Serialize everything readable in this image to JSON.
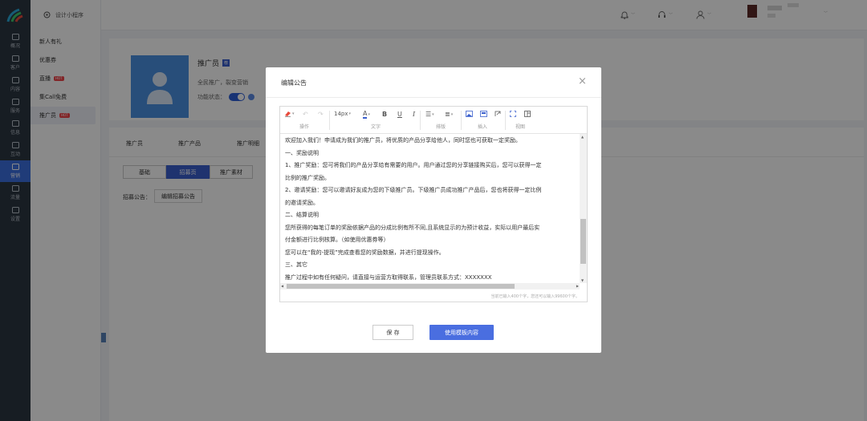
{
  "app_title": "设计小程序",
  "left_nav": [
    {
      "label": "概况",
      "icon": "bar-chart-icon"
    },
    {
      "label": "客户",
      "icon": "users-icon"
    },
    {
      "label": "内容",
      "icon": "document-icon"
    },
    {
      "label": "服务",
      "icon": "service-icon"
    },
    {
      "label": "信息",
      "icon": "message-icon"
    },
    {
      "label": "互动",
      "icon": "chat-icon"
    },
    {
      "label": "营销",
      "icon": "tag-icon",
      "active": true
    },
    {
      "label": "流量",
      "icon": "megaphone-icon"
    },
    {
      "label": "设置",
      "icon": "gear-icon"
    }
  ],
  "sub_nav": [
    {
      "label": "新人有礼"
    },
    {
      "label": "优惠券"
    },
    {
      "label": "直播",
      "hot": "HOT"
    },
    {
      "label": "集Call免费"
    },
    {
      "label": "推广员",
      "hot": "HOT",
      "active": true
    }
  ],
  "page": {
    "title": "推广员",
    "title_badge": "荐",
    "desc": "全民推广，裂变营销",
    "status_label": "功能状态：",
    "tabs": [
      "推广员",
      "推广产品",
      "推广明细"
    ],
    "segments": [
      "基础",
      "招募页",
      "推广素材"
    ],
    "notice_label": "招募公告：",
    "notice_button": "编辑招募公告"
  },
  "modal": {
    "title": "编辑公告",
    "toolbar_groups": [
      "操作",
      "文字",
      "排版",
      "插入",
      "视图"
    ],
    "font_size": "14px",
    "content_lines": [
      "欢迎加入我们！申请成为我们的推广员，将优质的产品分享给他人，同时您也可获取一定奖励。",
      "一、奖励说明",
      "1、推广奖励：您可将我们的产品分享给有需要的用户。用户通过您的分享链接购买后，您可以获得一定",
      "比例的推广奖励。",
      "2、邀请奖励：您可以邀请好友成为您的下级推广员。下级推广员成功推广产品后，您也将获得一定比例",
      "的邀请奖励。",
      "二、结算说明",
      "您所获得的每笔订单的奖励依据产品的分成比例有所不同,且系统显示的为预计收益，实际以用户最后实",
      "付金额进行比例核算。（如使用优惠券等）",
      "您可以在“我的-提现”完成查看您的奖励数据，并进行提现操作。",
      "三、其它",
      "推广过程中如有任何疑问，请直接与运营方取得联系，管理员联系方式：XXXXXXX"
    ],
    "counter": "当前已输入400个字，您还可以输入99600个字。",
    "save_button": "保 存",
    "template_button": "使用模板内容"
  },
  "colors": {
    "nav_bg": "#2b3642",
    "accent": "#3c6fe0",
    "primary_button": "#4a6ee0",
    "hot_badge": "#f0454a"
  }
}
